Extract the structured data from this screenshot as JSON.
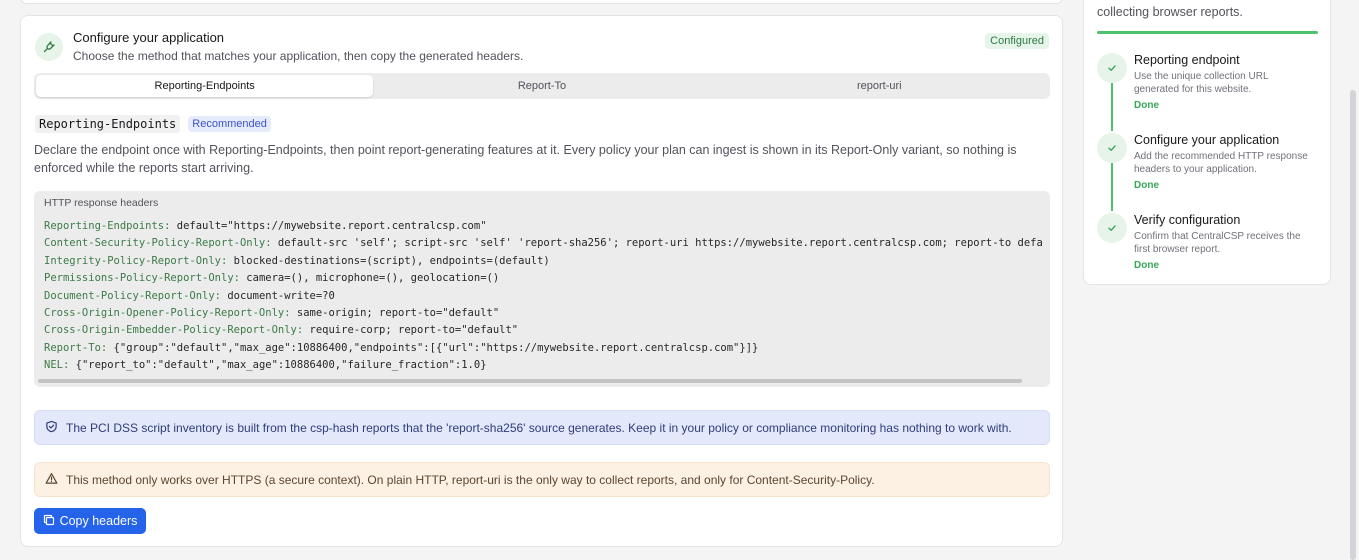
{
  "config": {
    "title": "Configure your application",
    "subtitle": "Choose the method that matches your application, then copy the generated headers.",
    "status_badge": "Configured",
    "icon": "plug-icon"
  },
  "tabs": [
    {
      "label": "Reporting-Endpoints",
      "active": true
    },
    {
      "label": "Report-To",
      "active": false
    },
    {
      "label": "report-uri",
      "active": false
    }
  ],
  "method": {
    "name": "Reporting-Endpoints",
    "badge": "Recommended",
    "description": "Declare the endpoint once with Reporting-Endpoints, then point report-generating features at it. Every policy your plan can ingest is shown in its Report-Only variant, so nothing is enforced while the reports start arriving."
  },
  "code": {
    "title": "HTTP response headers",
    "lines": [
      {
        "key": "Reporting-Endpoints:",
        "value": "default=\"https://mywebsite.report.centralcsp.com\""
      },
      {
        "key": "Content-Security-Policy-Report-Only:",
        "value": "default-src 'self'; script-src 'self' 'report-sha256'; report-uri https://mywebsite.report.centralcsp.com; report-to defa"
      },
      {
        "key": "Integrity-Policy-Report-Only:",
        "value": "blocked-destinations=(script), endpoints=(default)"
      },
      {
        "key": "Permissions-Policy-Report-Only:",
        "value": "camera=(), microphone=(), geolocation=()"
      },
      {
        "key": "Document-Policy-Report-Only:",
        "value": "document-write=?0"
      },
      {
        "key": "Cross-Origin-Opener-Policy-Report-Only:",
        "value": "same-origin; report-to=\"default\""
      },
      {
        "key": "Cross-Origin-Embedder-Policy-Report-Only:",
        "value": "require-corp; report-to=\"default\""
      },
      {
        "key": "Report-To:",
        "value": "{\"group\":\"default\",\"max_age\":10886400,\"endpoints\":[{\"url\":\"https://mywebsite.report.centralcsp.com\"}]}"
      },
      {
        "key": "NEL:",
        "value": "{\"report_to\":\"default\",\"max_age\":10886400,\"failure_fraction\":1.0}"
      }
    ]
  },
  "alerts": {
    "info": {
      "icon": "shield-check-icon",
      "text": "The PCI DSS script inventory is built from the csp-hash reports that the 'report-sha256' source generates. Keep it in your policy or compliance monitoring has nothing to work with."
    },
    "warning": {
      "icon": "warning-triangle-icon",
      "text": "This method only works over HTTPS (a secure context). On plain HTTP, report-uri is the only way to collect reports, and only for Content-Security-Policy."
    }
  },
  "copy_button": {
    "label": "Copy headers",
    "icon": "copy-icon"
  },
  "sidebar": {
    "top_text": "collecting browser reports.",
    "progress": 1.0,
    "steps": [
      {
        "title": "Reporting endpoint",
        "desc": "Use the unique collection URL generated for this website.",
        "status": "Done"
      },
      {
        "title": "Configure your application",
        "desc": "Add the recommended HTTP response headers to your application.",
        "status": "Done"
      },
      {
        "title": "Verify configuration",
        "desc": "Confirm that CentralCSP receives the first browser report.",
        "status": "Done"
      }
    ]
  },
  "colors": {
    "accent": "#2563eb",
    "success": "#38a856",
    "code_key": "#3d7a48"
  }
}
